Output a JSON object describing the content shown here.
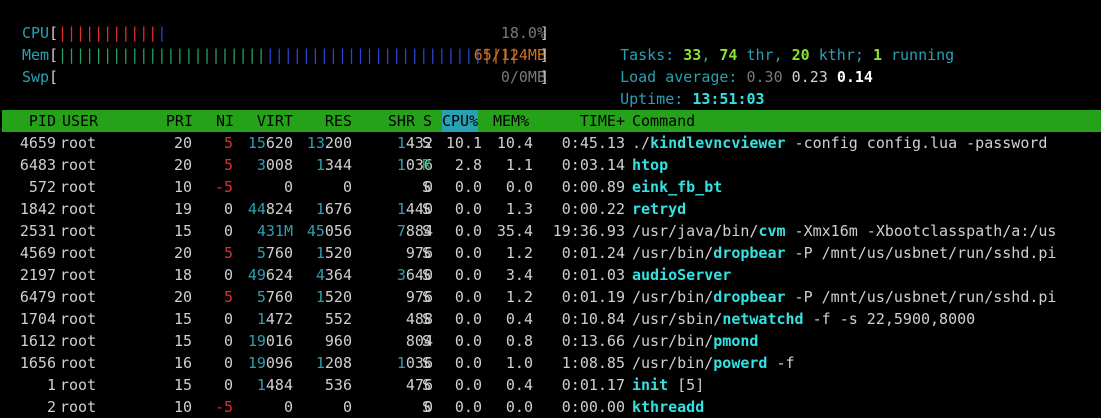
{
  "meters": {
    "cpu": {
      "label": "CPU",
      "value": "18.0%",
      "bar_red": "|||||||||||",
      "bar_blue": "|",
      "fraction": 0.18
    },
    "mem": {
      "label": "Mem",
      "value": "65/124MB",
      "bar_green": "|||||||||||||||||||||||",
      "bar_blue": "||||||||||||||||||||||||",
      "bar_orange": "||||",
      "fraction": 0.52
    },
    "swp": {
      "label": "Swp",
      "value": "0/0MB",
      "fraction": 0
    }
  },
  "summary": {
    "tasks_label": "Tasks:",
    "tasks": "33",
    "thr": "74",
    "thr_label": "thr,",
    "kthr": "20",
    "kthr_label": "kthr;",
    "running": "1",
    "running_label": "running",
    "load_label": "Load average:",
    "load1": "0.30",
    "load5": "0.23",
    "load15": "0.14",
    "uptime_label": "Uptime:",
    "uptime": "13:51:03"
  },
  "columns": [
    "PID",
    "USER",
    "PRI",
    "NI",
    "VIRT",
    "RES",
    "SHR",
    "S",
    "CPU%",
    "MEM%",
    "TIME+",
    "Command"
  ],
  "sorted_column": "CPU%",
  "processes": [
    {
      "pid": "4659",
      "user": "root",
      "pri": "20",
      "ni": "5",
      "virt": "15620",
      "res": "13200",
      "shr": "1432",
      "s": "S",
      "cpu": "10.1",
      "mem": "10.4",
      "time": "0:45.13",
      "cmd_path": "./",
      "cmd_bin": "kindlevncviewer",
      "cmd_args": " -config config.lua -password"
    },
    {
      "pid": "6483",
      "user": "root",
      "pri": "20",
      "ni": "5",
      "virt": "3008",
      "res": "1344",
      "shr": "1036",
      "s": "R",
      "cpu": "2.8",
      "mem": "1.1",
      "time": "0:03.14",
      "cmd_path": "",
      "cmd_bin": "htop",
      "cmd_args": ""
    },
    {
      "pid": "572",
      "user": "root",
      "pri": "10",
      "ni": "-5",
      "virt": "0",
      "res": "0",
      "shr": "0",
      "s": "S",
      "cpu": "0.0",
      "mem": "0.0",
      "time": "0:00.89",
      "cmd_path": "",
      "cmd_bin": "eink_fb_bt",
      "cmd_args": ""
    },
    {
      "pid": "1842",
      "user": "root",
      "pri": "19",
      "ni": "0",
      "virt": "44824",
      "res": "1676",
      "shr": "1440",
      "s": "S",
      "cpu": "0.0",
      "mem": "1.3",
      "time": "0:00.22",
      "cmd_path": "",
      "cmd_bin": "retryd",
      "cmd_args": ""
    },
    {
      "pid": "2531",
      "user": "root",
      "pri": "15",
      "ni": "0",
      "virt": "431M",
      "res": "45056",
      "shr": "7884",
      "s": "S",
      "cpu": "0.0",
      "mem": "35.4",
      "time": "19:36.93",
      "cmd_path": "/usr/java/bin/",
      "cmd_bin": "cvm",
      "cmd_args": " -Xmx16m -Xbootclasspath/a:/us"
    },
    {
      "pid": "4569",
      "user": "root",
      "pri": "20",
      "ni": "5",
      "virt": "5760",
      "res": "1520",
      "shr": "976",
      "s": "S",
      "cpu": "0.0",
      "mem": "1.2",
      "time": "0:01.24",
      "cmd_path": "/usr/bin/",
      "cmd_bin": "dropbear",
      "cmd_args": " -P /mnt/us/usbnet/run/sshd.pi"
    },
    {
      "pid": "2197",
      "user": "root",
      "pri": "18",
      "ni": "0",
      "virt": "49624",
      "res": "4364",
      "shr": "3640",
      "s": "S",
      "cpu": "0.0",
      "mem": "3.4",
      "time": "0:01.03",
      "cmd_path": "",
      "cmd_bin": "audioServer",
      "cmd_args": ""
    },
    {
      "pid": "6479",
      "user": "root",
      "pri": "20",
      "ni": "5",
      "virt": "5760",
      "res": "1520",
      "shr": "976",
      "s": "S",
      "cpu": "0.0",
      "mem": "1.2",
      "time": "0:01.19",
      "cmd_path": "/usr/bin/",
      "cmd_bin": "dropbear",
      "cmd_args": " -P /mnt/us/usbnet/run/sshd.pi"
    },
    {
      "pid": "1704",
      "user": "root",
      "pri": "15",
      "ni": "0",
      "virt": "1472",
      "res": "552",
      "shr": "488",
      "s": "S",
      "cpu": "0.0",
      "mem": "0.4",
      "time": "0:10.84",
      "cmd_path": "/usr/sbin/",
      "cmd_bin": "netwatchd",
      "cmd_args": " -f -s 22,5900,8000"
    },
    {
      "pid": "1612",
      "user": "root",
      "pri": "15",
      "ni": "0",
      "virt": "19016",
      "res": "960",
      "shr": "804",
      "s": "S",
      "cpu": "0.0",
      "mem": "0.8",
      "time": "0:13.66",
      "cmd_path": "/usr/bin/",
      "cmd_bin": "pmond",
      "cmd_args": ""
    },
    {
      "pid": "1656",
      "user": "root",
      "pri": "16",
      "ni": "0",
      "virt": "19096",
      "res": "1208",
      "shr": "1036",
      "s": "S",
      "cpu": "0.0",
      "mem": "1.0",
      "time": "1:08.85",
      "cmd_path": "/usr/bin/",
      "cmd_bin": "powerd",
      "cmd_args": " -f"
    },
    {
      "pid": "1",
      "user": "root",
      "pri": "15",
      "ni": "0",
      "virt": "1484",
      "res": "536",
      "shr": "476",
      "s": "S",
      "cpu": "0.0",
      "mem": "0.4",
      "time": "0:01.17",
      "cmd_path": "",
      "cmd_bin": "init",
      "cmd_args": " [5]"
    },
    {
      "pid": "2",
      "user": "root",
      "pri": "10",
      "ni": "-5",
      "virt": "0",
      "res": "0",
      "shr": "0",
      "s": "S",
      "cpu": "0.0",
      "mem": "0.0",
      "time": "0:00.00",
      "cmd_path": "",
      "cmd_bin": "kthreadd",
      "cmd_args": ""
    }
  ],
  "colors": {
    "header_bg": "#26a21a",
    "sorted_bg": "#2aa1b3",
    "label_cyan": "#2aa1b3",
    "value_green": "#8ae234",
    "binary_cyan": "#34e2e2",
    "nice_red": "#e0302a"
  }
}
